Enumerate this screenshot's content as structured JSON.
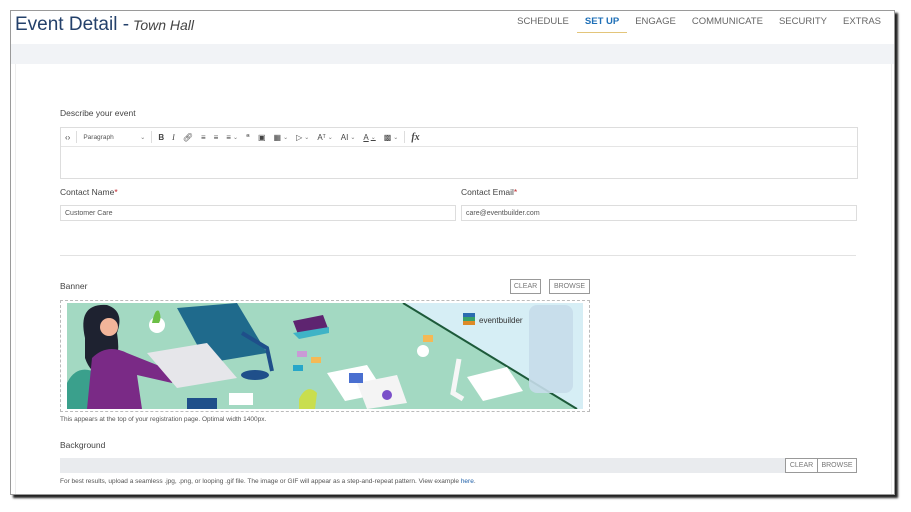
{
  "header": {
    "title": "Event Detail -",
    "event_name": "Town Hall"
  },
  "tabs": [
    {
      "label": "SCHEDULE",
      "active": false
    },
    {
      "label": "SET UP",
      "active": true
    },
    {
      "label": "ENGAGE",
      "active": false
    },
    {
      "label": "COMMUNICATE",
      "active": false
    },
    {
      "label": "SECURITY",
      "active": false
    },
    {
      "label": "EXTRAS",
      "active": false
    }
  ],
  "description": {
    "label": "Describe your event",
    "toolbar": {
      "source_icon": "code-icon",
      "paragraph_select": "Paragraph",
      "buttons": [
        "bold-icon",
        "italic-icon",
        "link-icon",
        "bulleted-list-icon",
        "numbered-list-icon",
        "align-icon",
        "blockquote-icon",
        "image-icon",
        "table-icon",
        "media-icon",
        "font-size-icon",
        "font-family-icon",
        "font-color-icon",
        "highlight-icon",
        "formula-icon"
      ]
    },
    "value": ""
  },
  "contact_name": {
    "label": "Contact Name",
    "required_mark": "*",
    "value": "Customer Care"
  },
  "contact_email": {
    "label": "Contact Email",
    "required_mark": "*",
    "value": "care@eventbuilder.com"
  },
  "banner": {
    "label": "Banner",
    "clear_label": "CLEAR",
    "browse_label": "BROWSE",
    "brand_text": "eventbuilder",
    "helper": "This appears at the top of your registration page. Optimal width 1400px."
  },
  "background": {
    "label": "Background",
    "clear_label": "CLEAR",
    "browse_label": "BROWSE",
    "helper": "For best results, upload a seamless .jpg, .png, or looping .gif file. The image or GIF will appear as a step-and-repeat pattern. View example",
    "link_text": "here",
    "helper_end": "."
  },
  "colors": {
    "title": "#24416b",
    "active_tab": "#1e6fb7",
    "active_underline": "#e3c57a",
    "required": "#c0282d"
  }
}
